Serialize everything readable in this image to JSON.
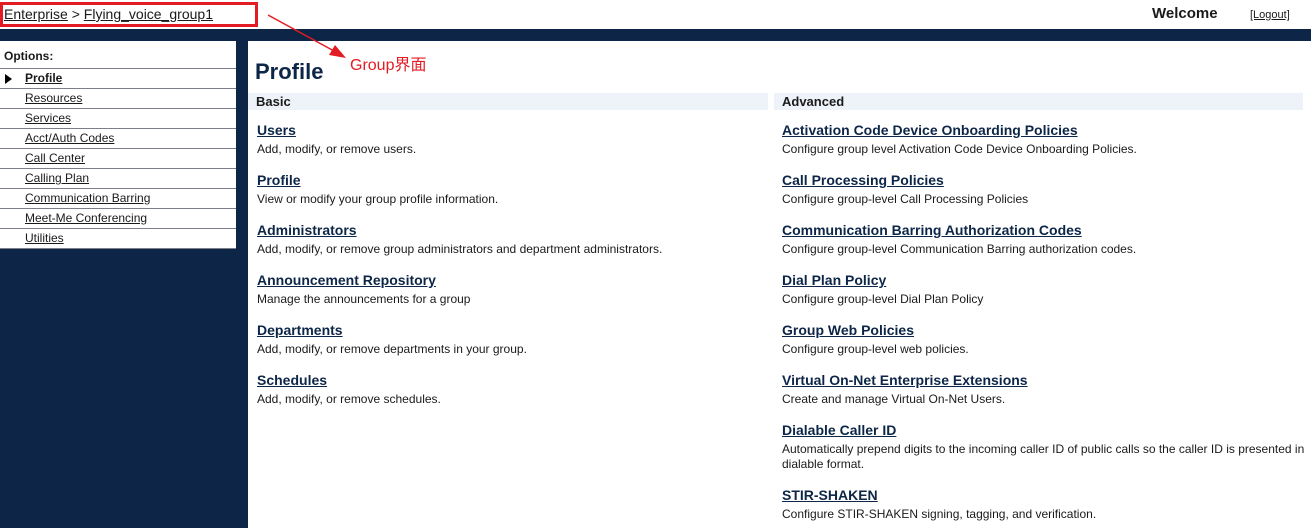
{
  "breadcrumb": {
    "enterprise": "Enterprise",
    "separator": ">",
    "group": "Flying_voice_group1"
  },
  "header": {
    "welcome": "Welcome",
    "logout": "[Logout]"
  },
  "annotation": {
    "label": "Group界面",
    "color": "#e31b23"
  },
  "sidebar": {
    "title": "Options:",
    "items": [
      {
        "label": "Profile",
        "active": true
      },
      {
        "label": "Resources"
      },
      {
        "label": "Services"
      },
      {
        "label": "Acct/Auth Codes"
      },
      {
        "label": "Call Center"
      },
      {
        "label": "Calling Plan"
      },
      {
        "label": "Communication Barring"
      },
      {
        "label": "Meet-Me Conferencing"
      },
      {
        "label": "Utilities"
      }
    ]
  },
  "main": {
    "title": "Profile",
    "basic": {
      "heading": "Basic",
      "items": [
        {
          "link": "Users",
          "desc": "Add, modify, or remove users."
        },
        {
          "link": "Profile",
          "desc": "View or modify your group profile information."
        },
        {
          "link": "Administrators",
          "desc": "Add, modify, or remove group administrators and department administrators."
        },
        {
          "link": "Announcement Repository",
          "desc": "Manage the announcements for a group"
        },
        {
          "link": "Departments",
          "desc": "Add, modify, or remove departments in your group."
        },
        {
          "link": "Schedules",
          "desc": "Add, modify, or remove schedules."
        }
      ]
    },
    "advanced": {
      "heading": "Advanced",
      "items": [
        {
          "link": "Activation Code Device Onboarding Policies",
          "desc": "Configure group level Activation Code Device Onboarding Policies."
        },
        {
          "link": "Call Processing Policies",
          "desc": "Configure group-level Call Processing Policies"
        },
        {
          "link": "Communication Barring Authorization Codes",
          "desc": "Configure group-level Communication Barring authorization codes."
        },
        {
          "link": "Dial Plan Policy",
          "desc": "Configure group-level Dial Plan Policy"
        },
        {
          "link": "Group Web Policies",
          "desc": "Configure group-level web policies."
        },
        {
          "link": "Virtual On-Net Enterprise Extensions",
          "desc": "Create and manage Virtual On-Net Users."
        },
        {
          "link": "Dialable Caller ID",
          "desc": "Automatically prepend digits to the incoming caller ID of public calls so the caller ID is presented in dialable format."
        },
        {
          "link": "STIR-SHAKEN",
          "desc": "Configure STIR-SHAKEN signing, tagging, and verification."
        }
      ]
    }
  },
  "colors": {
    "navy": "#0d2647",
    "section_bg": "#eef3f9"
  }
}
